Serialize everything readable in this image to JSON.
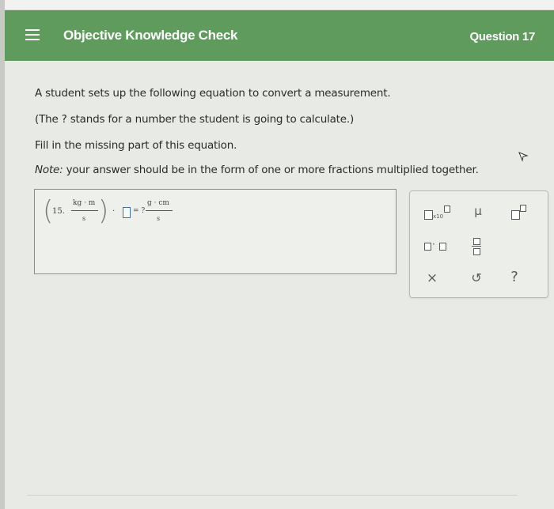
{
  "header": {
    "title": "Objective Knowledge Check",
    "question_label": "Question 17",
    "colors": {
      "bar": "#5e9b5c",
      "text": "#ffffff"
    }
  },
  "prompt": {
    "line1": "A student sets up the following equation to convert a measurement.",
    "line2": "(The ? stands for a number the student is going to calculate.)",
    "line3": "Fill in the missing part of this equation.",
    "note_label": "Note:",
    "note_text": "your answer should be in the form of one or more fractions multiplied together."
  },
  "equation": {
    "coefficient": "15.",
    "left_num": "kg · m",
    "left_den": "s",
    "dot": "·",
    "equals": "= ?",
    "right_num": "g · cm",
    "right_den": "s"
  },
  "toolbox": {
    "sci_notation_label": "x10",
    "mu": "μ",
    "dot_product": "·",
    "clear": "×",
    "undo": "↺",
    "help": "?"
  }
}
